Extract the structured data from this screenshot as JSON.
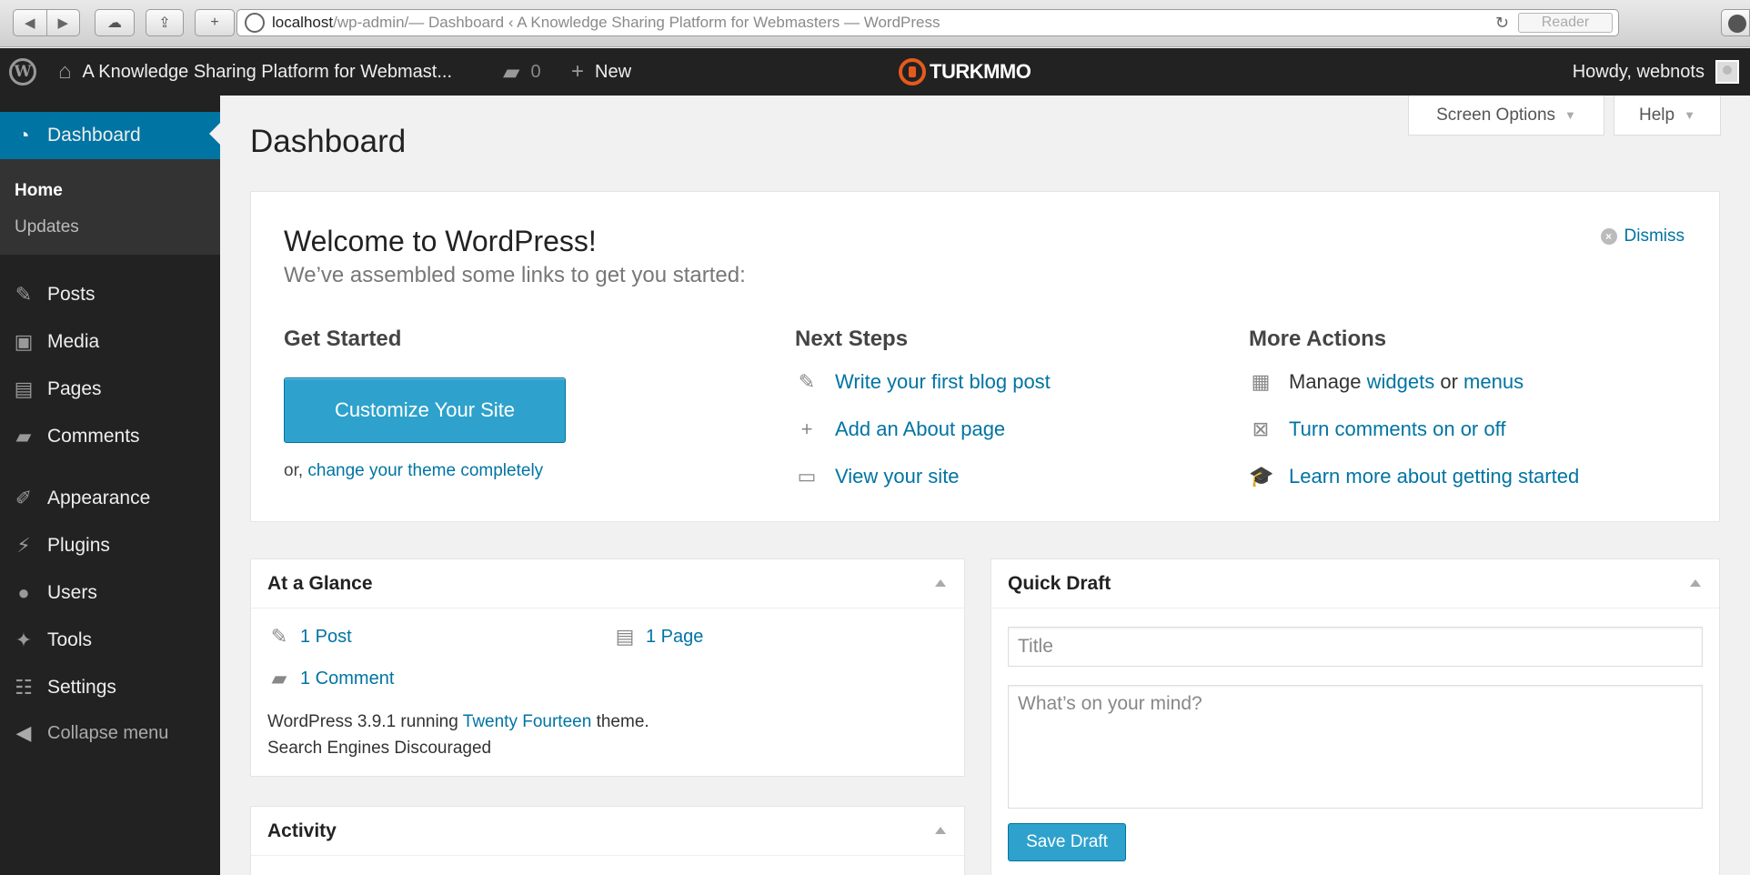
{
  "browser": {
    "url_host": "localhost",
    "url_path": "/wp-admin/",
    "url_title": " — Dashboard ‹ A Knowledge Sharing Platform for Webmasters — WordPress",
    "reader_label": "Reader"
  },
  "admin_bar": {
    "site_name": "A Knowledge Sharing Platform for Webmast...",
    "comment_count": "0",
    "new_label": "New",
    "brand": "TURKMMO",
    "howdy": "Howdy, webnots"
  },
  "sidebar": {
    "dashboard_label": "Dashboard",
    "submenu": [
      {
        "label": "Home"
      },
      {
        "label": "Updates"
      }
    ],
    "items": [
      {
        "label": "Posts",
        "icon": "pin-icon"
      },
      {
        "label": "Media",
        "icon": "media-icon"
      },
      {
        "label": "Pages",
        "icon": "pages-icon"
      },
      {
        "label": "Comments",
        "icon": "comment-icon"
      },
      {
        "label": "Appearance",
        "icon": "brush-icon"
      },
      {
        "label": "Plugins",
        "icon": "plug-icon"
      },
      {
        "label": "Users",
        "icon": "user-icon"
      },
      {
        "label": "Tools",
        "icon": "wrench-icon"
      },
      {
        "label": "Settings",
        "icon": "settings-icon"
      }
    ],
    "collapse_label": "Collapse menu"
  },
  "header": {
    "screen_options": "Screen Options",
    "help": "Help",
    "page_title": "Dashboard"
  },
  "welcome": {
    "title": "Welcome to WordPress!",
    "about": "We’ve assembled some links to get you started:",
    "dismiss": "Dismiss",
    "get_started": "Get Started",
    "customize_button": "Customize Your Site",
    "or_prefix": "or,",
    "change_theme": "change your theme completely",
    "next_steps": "Next Steps",
    "next": [
      {
        "label": "Write your first blog post"
      },
      {
        "label": "Add an About page"
      },
      {
        "label": "View your site"
      }
    ],
    "more_actions": "More Actions",
    "manage_prefix": "Manage",
    "widgets": "widgets",
    "or_word": "or",
    "menus": "menus",
    "comments_toggle": "Turn comments on or off",
    "learn_more": "Learn more about getting started"
  },
  "glance": {
    "title": "At a Glance",
    "posts": "1 Post",
    "pages": "1 Page",
    "comments": "1 Comment",
    "version_prefix": "WordPress 3.9.1 running",
    "theme_name": "Twenty Fourteen",
    "version_suffix": "theme.",
    "search_engines": "Search Engines Discouraged"
  },
  "activity": {
    "title": "Activity"
  },
  "quick_draft": {
    "title": "Quick Draft",
    "title_placeholder": "Title",
    "content_placeholder": "What’s on your mind?",
    "save_label": "Save Draft"
  }
}
